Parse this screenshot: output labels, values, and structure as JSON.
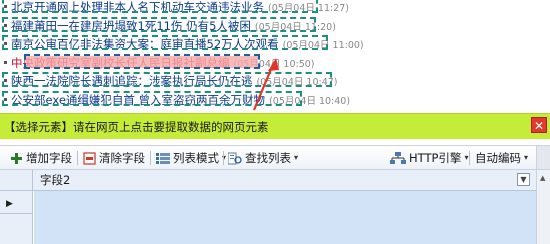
{
  "news": [
    {
      "title": "北京开通网上处理非本人名下机动车交通违法业务",
      "time": "(05月04日 11:27)",
      "boxed": true,
      "selected": false,
      "box_width": 316
    },
    {
      "title": "福建莆田一在建房坍塌致1死11伤 仍有5人被困",
      "time": "(05月04日 11:20)",
      "boxed": true,
      "selected": false,
      "box_width": 314
    },
    {
      "title": "南京公审百亿非法集资大案：庭审直播52万人次观看",
      "time": "(05月04日 11:00)",
      "boxed": true,
      "selected": false,
      "box_width": 326
    },
    {
      "title": "中央政策研究室副校长任人民日报社副总编",
      "time": "(05月04日 10:50)",
      "boxed": false,
      "selected": true,
      "box_width": 0
    },
    {
      "title": "陕西一法院院长遇刺追踪：涉案执行局长仍在逃",
      "time": "(05月04日 10:47)",
      "boxed": true,
      "selected": false,
      "box_width": 330
    },
    {
      "title": "公安部exe通缉嫌犯自首 曾入室盗窃两百余万财物",
      "time": "(05月04日 10:40)",
      "boxed": true,
      "selected": false,
      "box_width": 300
    }
  ],
  "tip_bar": {
    "text": "【选择元素】请在网页上点击要提取数据的网页元素",
    "close_label": "✕"
  },
  "toolbar": {
    "add_field": "增加字段",
    "clear_field": "清除字段",
    "list_mode": "列表模式",
    "find_list": "查找列表",
    "http_engine": "HTTP引擎",
    "auto_encoding": "自动编码"
  },
  "grid": {
    "column_header": "字段2",
    "row_indicator": "▶"
  },
  "colors": {
    "tip_bar_bg": "#c6ec3a",
    "selection_box": "#1e8e7e",
    "highlight": "#f5a9a9",
    "arrow": "#e0352b",
    "grid_cell": "#d3e3f7"
  }
}
